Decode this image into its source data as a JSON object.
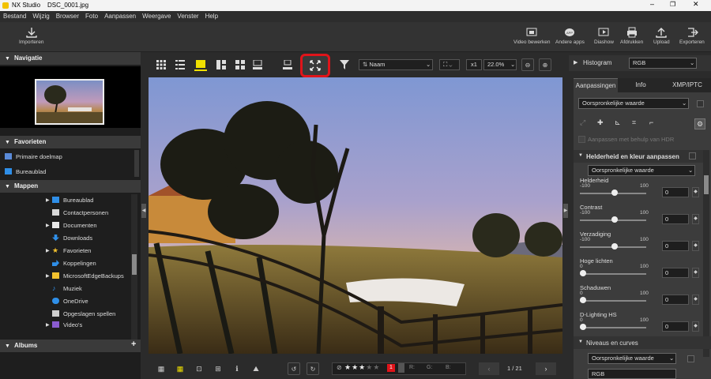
{
  "titlebar": {
    "app": "NX Studio",
    "file": "DSC_0001.jpg"
  },
  "menu": [
    "Bestand",
    "Wijzig",
    "Browser",
    "Foto",
    "Aanpassen",
    "Weergave",
    "Venster",
    "Help"
  ],
  "toolbar": {
    "import": "Importeren",
    "video": "Video bewerken",
    "apps": "Andere apps",
    "slideshow": "Diashow",
    "print": "Afdrukken",
    "upload": "Upload",
    "export": "Exporteren"
  },
  "left": {
    "navigation": "Navigatie",
    "favorites": "Favorieten",
    "fav_items": [
      "Primaire doelmap",
      "Bureaublad"
    ],
    "folders": "Mappen",
    "folder_items": [
      "Bureaublad",
      "Contactpersonen",
      "Documenten",
      "Downloads",
      "Favorieten",
      "Koppelingen",
      "MicrosoftEdgeBackups",
      "Muziek",
      "OneDrive",
      "Opgeslagen spellen",
      "Video's"
    ],
    "albums": "Albums",
    "albums_add": "+"
  },
  "viewbar": {
    "sort": "Naam",
    "zoom_mult": "x1",
    "zoom": "22.0%"
  },
  "bottombar": {
    "flag": "1",
    "r": "R:",
    "g": "G:",
    "b": "B:",
    "counter": "1 / 21",
    "rating": 3
  },
  "right": {
    "histogram": "Histogram",
    "channel": "RGB",
    "tabs": [
      "Aanpassingen",
      "Info",
      "XMP/IPTC"
    ],
    "preset": "Oorspronkelijke waarde",
    "hdr": "Aanpassen met behulp van HDR",
    "section1": "Helderheid en kleur aanpassen",
    "section1_preset": "Oorspronkelijke waarde",
    "sliders": [
      {
        "label": "Helderheid",
        "min": "-100",
        "max": "100",
        "value": "0",
        "level": 0.5
      },
      {
        "label": "Contrast",
        "min": "-100",
        "max": "100",
        "value": "0",
        "level": 0.5
      },
      {
        "label": "Verzadiging",
        "min": "-100",
        "max": "100",
        "value": "0",
        "level": 0.5
      },
      {
        "label": "Hoge lichten",
        "min": "0",
        "max": "100",
        "value": "0",
        "level": 0
      },
      {
        "label": "Schaduwen",
        "min": "0",
        "max": "100",
        "value": "0",
        "level": 0
      },
      {
        "label": "D-Lighting HS",
        "min": "0",
        "max": "100",
        "value": "0",
        "level": 0
      }
    ],
    "section2": "Niveaus en curves",
    "section2_preset": "Oorspronkelijke waarde",
    "section2_channel": "RGB"
  },
  "colors": {
    "highlight": "#e0141a",
    "folder_blue": "#2f8fe8",
    "folder_yellow": "#f2c12e",
    "accent": "#f0e000"
  }
}
